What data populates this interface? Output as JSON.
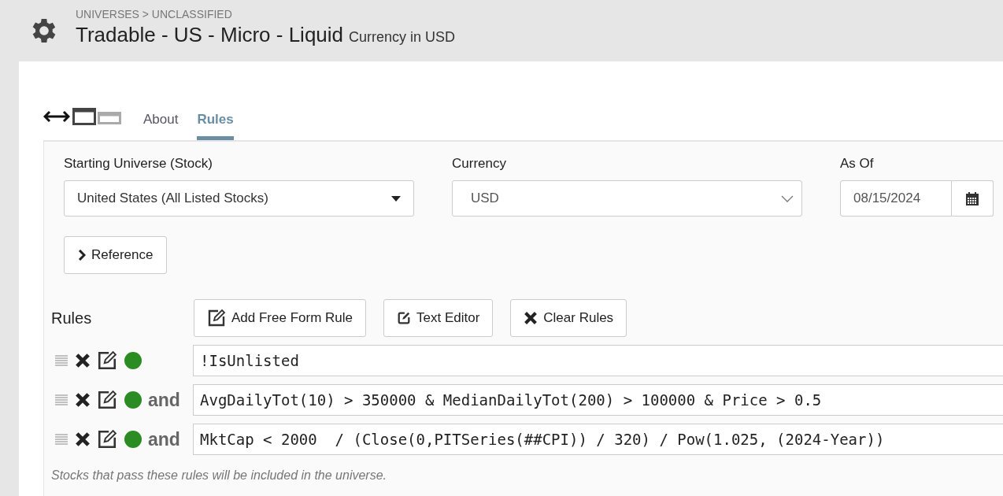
{
  "header": {
    "breadcrumb": "UNIVERSES > UNCLASSIFIED",
    "title": "Tradable - US - Micro - Liquid",
    "subtitle": "Currency in USD"
  },
  "tabs": [
    {
      "label": "About",
      "selected": false
    },
    {
      "label": "Rules",
      "selected": true
    }
  ],
  "fields": [
    {
      "kind": "dropdown",
      "label": "Starting Universe (Stock)",
      "value": "United States (All Listed Stocks)"
    },
    {
      "kind": "select",
      "label": "Currency",
      "value": "USD"
    },
    {
      "kind": "date",
      "label": "As Of",
      "value": "08/15/2024"
    }
  ],
  "reference_button": "Reference",
  "rules_label": "Rules",
  "buttons": [
    {
      "kind": "add",
      "label": "Add Free Form Rule"
    },
    {
      "kind": "editor",
      "label": "Text Editor"
    },
    {
      "kind": "clear",
      "label": "Clear Rules"
    }
  ],
  "rules": [
    {
      "formula": "!IsUnlisted",
      "color": "#2a8c23"
    },
    {
      "connector": "and",
      "formula": "AvgDailyTot(10) > 350000 & MedianDailyTot(200) > 100000 & Price > 0.5",
      "color": "#2a8c23"
    },
    {
      "connector": "and",
      "formula": "MktCap < 2000  / (Close(0,PITSeries(##CPI)) / 320) / Pow(1.025, (2024-Year))",
      "color": "#2a8c23"
    }
  ],
  "footnote": "Stocks that pass these rules will be included in the universe."
}
